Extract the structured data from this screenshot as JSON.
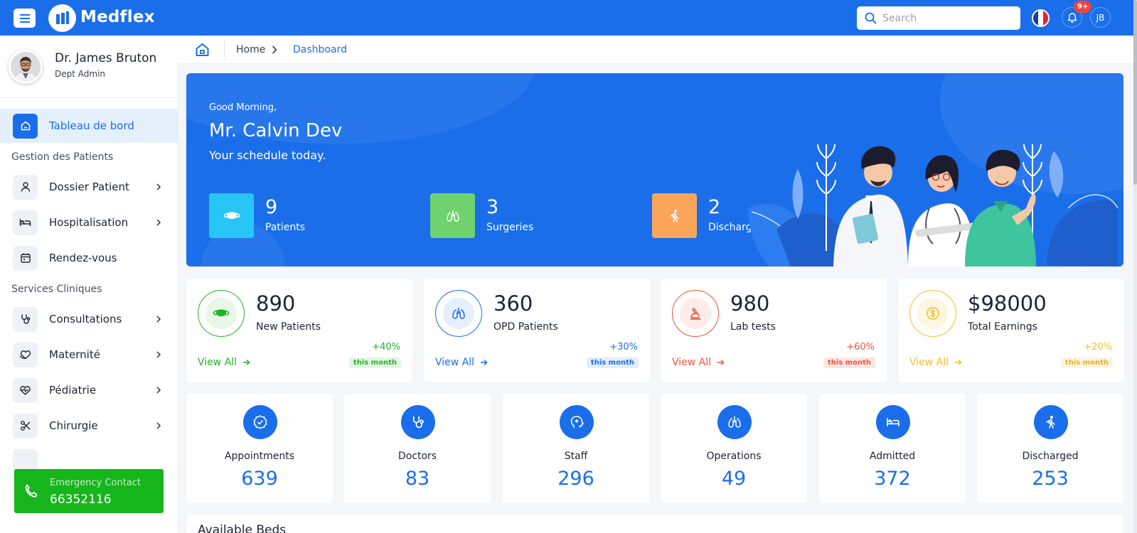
{
  "app": {
    "brand": "Medflex"
  },
  "topbar": {
    "search_placeholder": "Search",
    "notification_badge": "9+",
    "user_initials": "JB"
  },
  "sidebar": {
    "profile": {
      "name": "Dr. James Bruton",
      "role": "Dept Admin"
    },
    "items": [
      {
        "label": "Tableau de bord",
        "icon": "home-icon",
        "active": true
      },
      {
        "section": "Gestion des Patients"
      },
      {
        "label": "Dossier Patient",
        "icon": "user-icon",
        "chevron": true
      },
      {
        "label": "Hospitalisation",
        "icon": "bed-icon",
        "chevron": true
      },
      {
        "label": "Rendez-vous",
        "icon": "calendar-icon"
      },
      {
        "section": "Services Cliniques"
      },
      {
        "label": "Consultations",
        "icon": "stethoscope-icon",
        "chevron": true
      },
      {
        "label": "Maternité",
        "icon": "hands-heart-icon",
        "chevron": true
      },
      {
        "label": "Pédiatrie",
        "icon": "heartbeat-icon",
        "chevron": true
      },
      {
        "label": "Chirurgie",
        "icon": "scissors-icon",
        "chevron": true
      }
    ],
    "emergency": {
      "label": "Emergency Contact",
      "number": "66352116"
    }
  },
  "breadcrumb": {
    "home": "Home",
    "current": "Dashboard"
  },
  "hero": {
    "greeting": "Good Morning,",
    "name": "Mr. Calvin Dev",
    "subtitle": "Your schedule today.",
    "stats": [
      {
        "value": "9",
        "label": "Patients",
        "color": "#28c6f6",
        "icon": "mask-icon"
      },
      {
        "value": "3",
        "label": "Surgeries",
        "color": "#6fd26e",
        "icon": "lungs-icon"
      },
      {
        "value": "2",
        "label": "Discharges",
        "color": "#fba55a",
        "icon": "walking-icon"
      }
    ]
  },
  "stat_cards": [
    {
      "value": "890",
      "label": "New Patients",
      "link": "View All",
      "change": "+40%",
      "period": "this month",
      "color": "#22b227",
      "icon": "mask-icon"
    },
    {
      "value": "360",
      "label": "OPD Patients",
      "link": "View All",
      "change": "+30%",
      "period": "this month",
      "color": "#1a6eea",
      "icon": "lungs-icon"
    },
    {
      "value": "980",
      "label": "Lab tests",
      "link": "View All",
      "change": "+60%",
      "period": "this month",
      "color": "#f0533a",
      "icon": "microscope-icon"
    },
    {
      "value": "$98000",
      "label": "Total Earnings",
      "link": "View All",
      "change": "+20%",
      "period": "this month",
      "color": "#f3be2c",
      "icon": "dollar-coin-icon"
    }
  ],
  "mini_cards": [
    {
      "label": "Appointments",
      "value": "639",
      "icon": "badge-check-icon"
    },
    {
      "label": "Doctors",
      "value": "83",
      "icon": "stethoscope-icon"
    },
    {
      "label": "Staff",
      "value": "296",
      "icon": "head-medical-icon"
    },
    {
      "label": "Operations",
      "value": "49",
      "icon": "lungs-icon"
    },
    {
      "label": "Admitted",
      "value": "372",
      "icon": "bed-icon"
    },
    {
      "label": "Discharged",
      "value": "253",
      "icon": "walking-icon"
    }
  ],
  "beds": {
    "title": "Available Beds"
  }
}
